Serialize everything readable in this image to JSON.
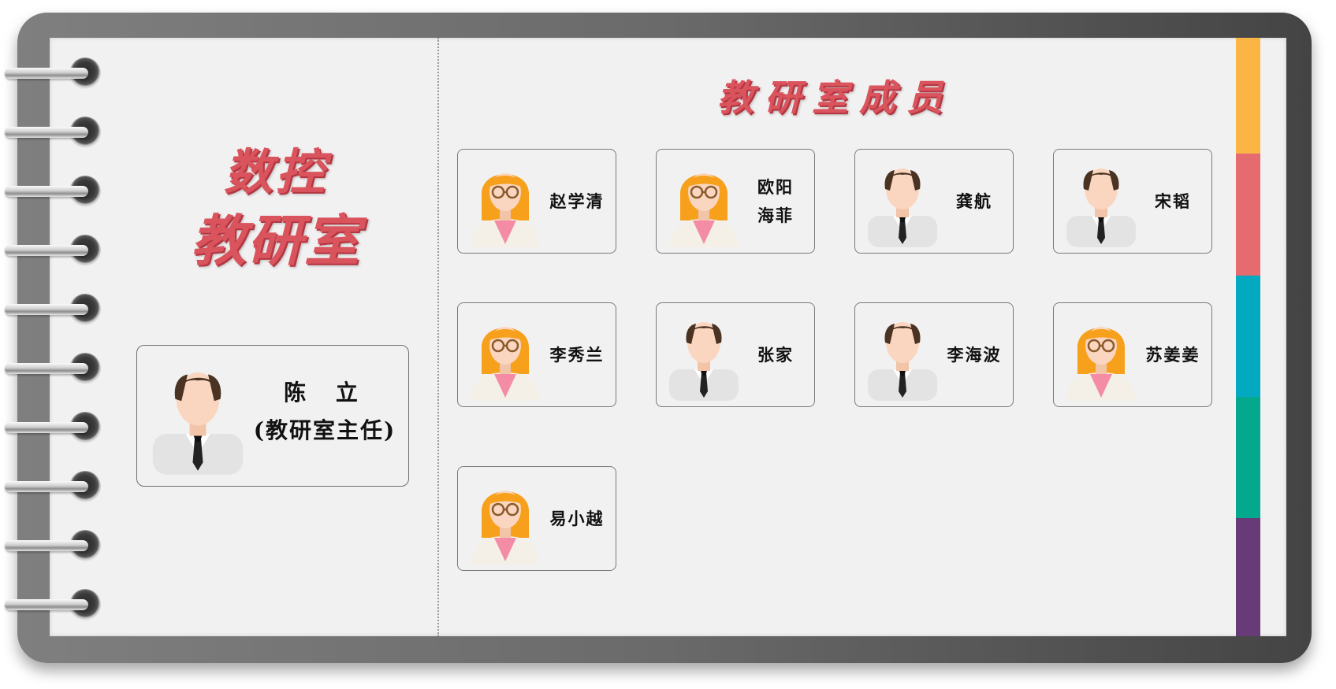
{
  "department": {
    "title_line1": "数控",
    "title_line2": "教研室",
    "members_heading": "教研室成员"
  },
  "leader": {
    "name": "陈 立",
    "role": "(教研室主任)",
    "avatar": "male-avatar-icon"
  },
  "members": [
    {
      "name": "赵学清",
      "avatar": "female-avatar-icon"
    },
    {
      "name": "欧阳\n海菲",
      "avatar": "female-avatar-icon"
    },
    {
      "name": "龚航",
      "avatar": "male-avatar-icon"
    },
    {
      "name": "宋韬",
      "avatar": "male-avatar-icon"
    },
    {
      "name": "李秀兰",
      "avatar": "female-avatar-icon"
    },
    {
      "name": "张家",
      "avatar": "male-avatar-icon"
    },
    {
      "name": "李海波",
      "avatar": "male-avatar-icon"
    },
    {
      "name": "苏姜姜",
      "avatar": "female-avatar-icon"
    },
    {
      "name": "易小越",
      "avatar": "female-avatar-icon"
    }
  ],
  "colors": {
    "title": "#d9545d",
    "tabs": [
      "#fbb545",
      "#e66b6f",
      "#03a9c0",
      "#03a88d",
      "#673a78"
    ]
  }
}
